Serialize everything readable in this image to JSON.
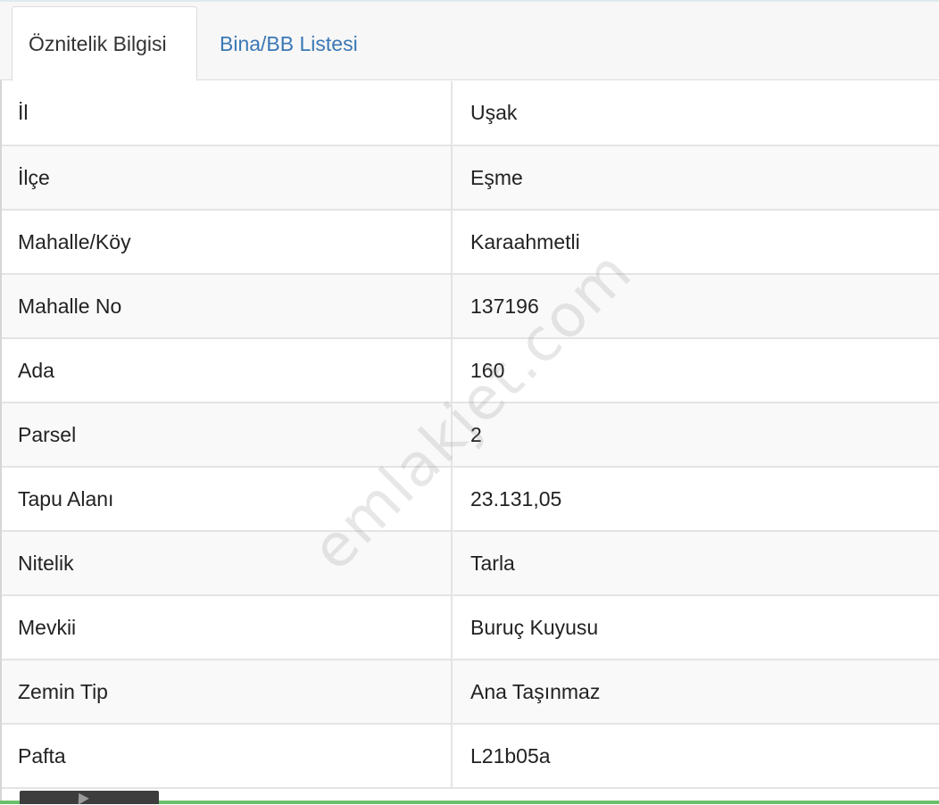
{
  "tabs": [
    {
      "label": "Öznitelik Bilgisi",
      "active": true
    },
    {
      "label": "Bina/BB Listesi",
      "active": false
    }
  ],
  "rows": [
    {
      "key": "İl",
      "value": "Uşak"
    },
    {
      "key": "İlçe",
      "value": "Eşme"
    },
    {
      "key": "Mahalle/Köy",
      "value": "Karaahmetli"
    },
    {
      "key": "Mahalle No",
      "value": "137196"
    },
    {
      "key": "Ada",
      "value": "160"
    },
    {
      "key": "Parsel",
      "value": "2"
    },
    {
      "key": "Tapu Alanı",
      "value": "23.131,05"
    },
    {
      "key": "Nitelik",
      "value": "Tarla"
    },
    {
      "key": "Mevkii",
      "value": "Buruç Kuyusu"
    },
    {
      "key": "Zemin Tip",
      "value": "Ana Taşınmaz"
    },
    {
      "key": "Pafta",
      "value": "L21b05a"
    }
  ],
  "watermark": "emlakjet.com",
  "colors": {
    "link": "#3a78b5",
    "row_stripe": "#f9f9f9",
    "border": "#e4e4e4",
    "bottom_accent": "#6bbf6b"
  },
  "icons": [
    "cursor-icon"
  ]
}
